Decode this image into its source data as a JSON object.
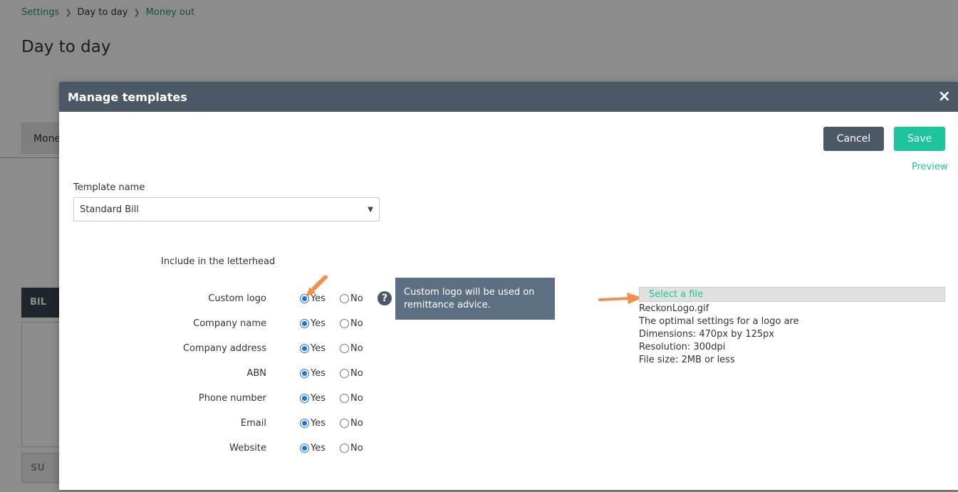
{
  "breadcrumb": {
    "items": [
      "Settings",
      "Day to day",
      "Money out"
    ]
  },
  "page": {
    "title": "Day to day",
    "tab_label": "Mone",
    "bill_button": "BIL",
    "submit_button": "SU"
  },
  "modal": {
    "title": "Manage templates",
    "close_glyph": "×",
    "cancel_label": "Cancel",
    "save_label": "Save",
    "preview_label": "Preview",
    "template_name_label": "Template name",
    "template_name_value": "Standard Bill",
    "letterhead_heading": "Include in the letterhead",
    "yes_label": "Yes",
    "no_label": "No",
    "options": [
      {
        "label": "Custom logo",
        "selected": "Yes"
      },
      {
        "label": "Company name",
        "selected": "Yes"
      },
      {
        "label": "Company address",
        "selected": "Yes"
      },
      {
        "label": "ABN",
        "selected": "Yes"
      },
      {
        "label": "Phone number",
        "selected": "Yes"
      },
      {
        "label": "Email",
        "selected": "Yes"
      },
      {
        "label": "Website",
        "selected": "Yes"
      }
    ],
    "help_glyph": "?",
    "tooltip_text": "Custom logo will be used on remittance advice.",
    "select_file_label": "Select a file",
    "file_name": "ReckonLogo.gif",
    "logo_info": [
      "The optimal settings for a logo are",
      "Dimensions: 470px by 125px",
      "Resolution: 300dpi",
      "File size: 2MB or less"
    ]
  },
  "colors": {
    "header": "#4b5866",
    "accent": "#1ec49c",
    "radio": "#1a73e8",
    "annotation_arrow": "#f0904a"
  }
}
